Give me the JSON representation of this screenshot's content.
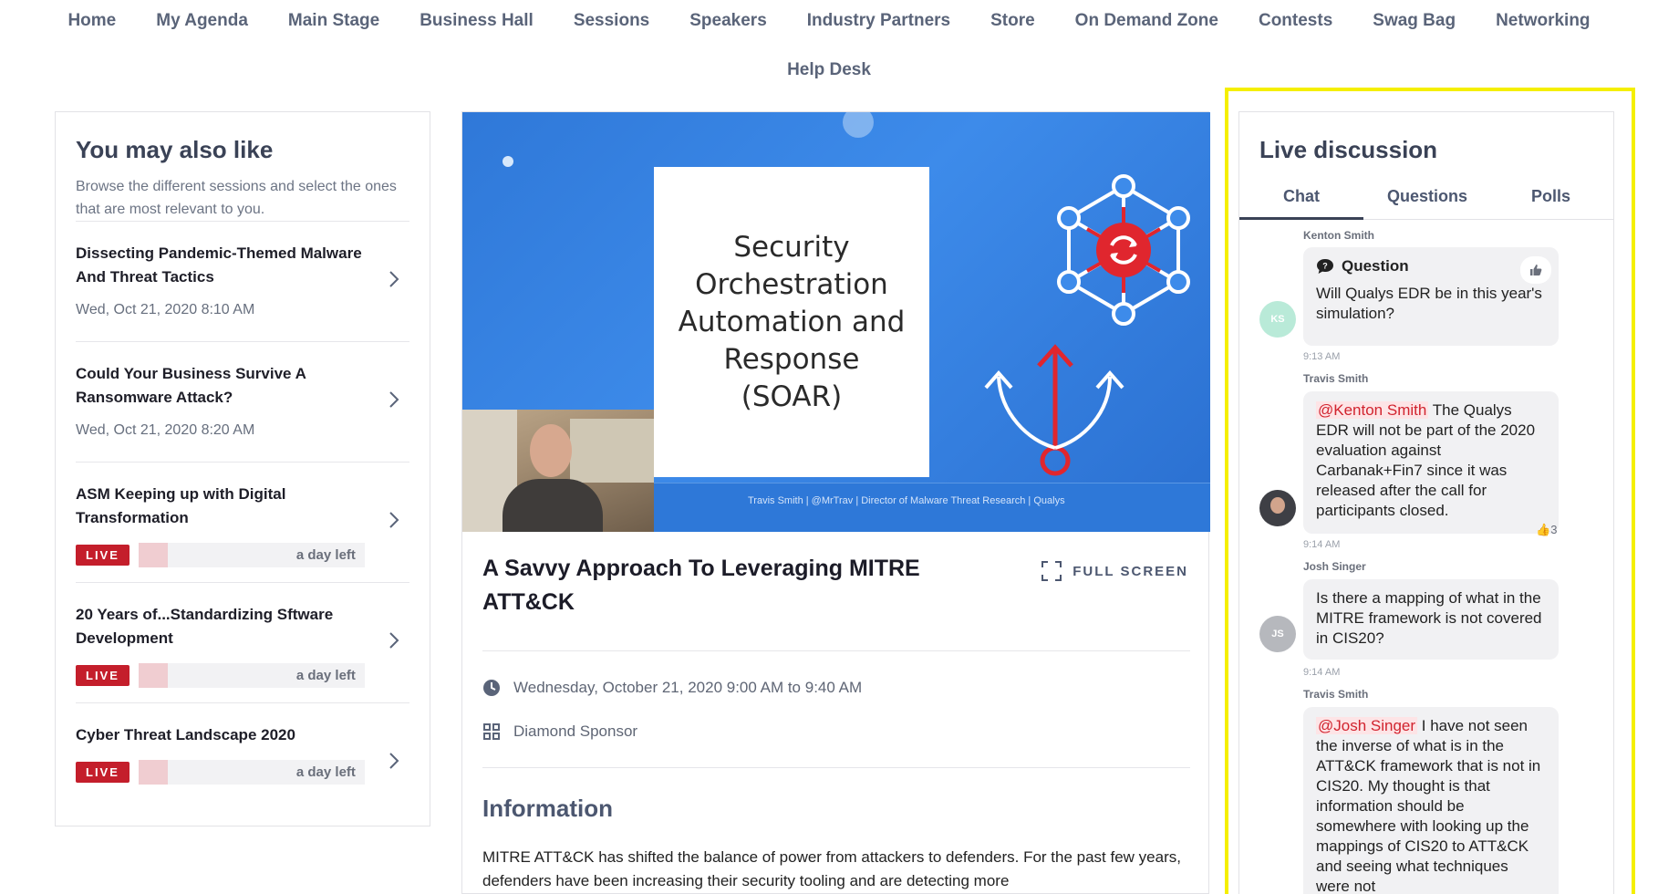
{
  "nav": {
    "items": [
      "Home",
      "My Agenda",
      "Main Stage",
      "Business Hall",
      "Sessions",
      "Speakers",
      "Industry Partners",
      "Store",
      "On Demand Zone",
      "Contests",
      "Swag Bag",
      "Networking",
      "Help Desk"
    ]
  },
  "left": {
    "title": "You may also like",
    "description": "Browse the different sessions and select the ones that are most relevant to you.",
    "sessions": [
      {
        "title": "Dissecting Pandemic-Themed Malware And Threat Tactics",
        "date": "Wed, Oct 21, 2020 8:10 AM"
      },
      {
        "title": "Could Your Business Survive A Ransomware Attack?",
        "date": "Wed, Oct 21, 2020 8:20 AM"
      },
      {
        "title": "ASM Keeping up with Digital Transformation",
        "live": "LIVE",
        "remaining": "a day left"
      },
      {
        "title": "20 Years of...Standardizing Sftware Development",
        "live": "LIVE",
        "remaining": "a day left"
      },
      {
        "title": "Cyber Threat Landscape 2020",
        "live": "LIVE",
        "remaining": "a day left"
      }
    ]
  },
  "video": {
    "slide_title_lines": [
      "Security",
      "Orchestration",
      "Automation and",
      "Response",
      "(SOAR)"
    ],
    "caption": "Travis Smith | @MrTrav | Director of Malware Threat Research | Qualys"
  },
  "talk": {
    "title": "A Savvy Approach To Leveraging MITRE ATT&CK",
    "fullscreen_label": "FULL SCREEN",
    "datetime": "Wednesday, October 21, 2020 9:00 AM to 9:40 AM",
    "sponsor": "Diamond Sponsor",
    "info_heading": "Information",
    "info_text": "MITRE ATT&CK has shifted the balance of power from attackers to defenders. For the past few years, defenders have been increasing their security tooling and are detecting more"
  },
  "discussion": {
    "title": "Live discussion",
    "tabs": [
      "Chat",
      "Questions",
      "Polls"
    ],
    "messages": [
      {
        "author": "Kenton Smith",
        "initials": "KS",
        "type_label": "Question",
        "text": "Will Qualys EDR be in this year's simulation?",
        "time": "9:13 AM"
      },
      {
        "author": "Travis Smith",
        "mention": "@Kenton Smith",
        "text": " The Qualys EDR will not be part of the 2020 evaluation against Carbanak+Fin7 since it was released after the call for participants closed.",
        "time": "9:14 AM",
        "reaction_count": "3"
      },
      {
        "author": "Josh Singer",
        "initials": "JS",
        "text": "Is there a mapping of what in the MITRE framework is not covered in CIS20?",
        "time": "9:14 AM"
      },
      {
        "author": "Travis Smith",
        "mention": "@Josh Singer",
        "text": " I have not seen the inverse of what is in the ATT&CK framework that is not in CIS20. My thought is that information should be somewhere with looking up the mappings of CIS20 to ATT&CK and seeing what techniques were not"
      }
    ]
  },
  "colors": {
    "accent": "#c41e2b",
    "nav_text": "#5a6479",
    "highlight": "#f5ef00",
    "video_blue": "#3d8bea"
  }
}
